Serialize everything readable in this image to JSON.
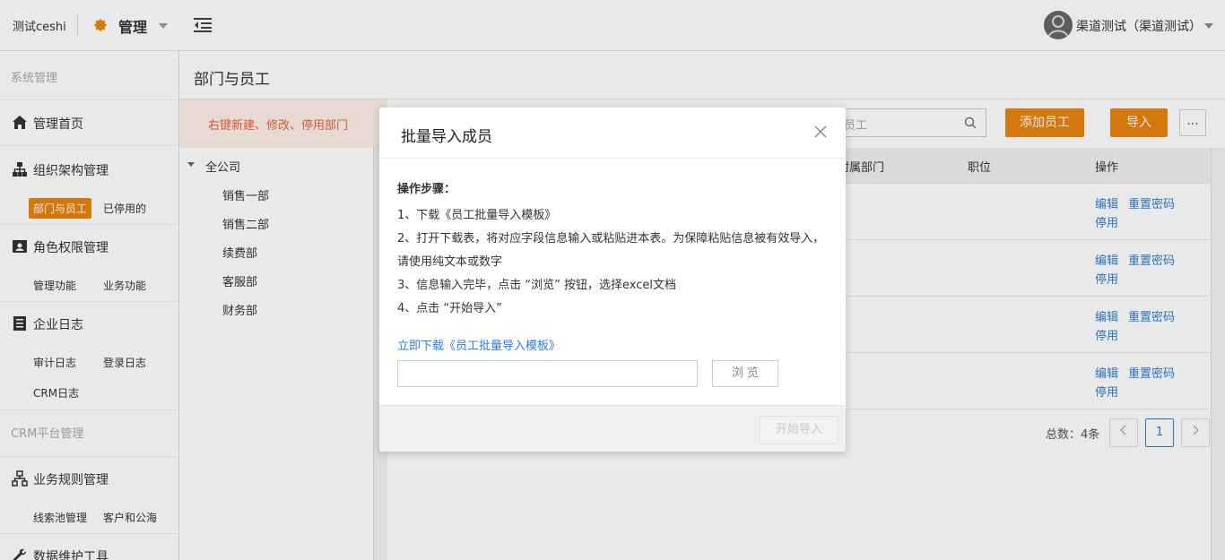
{
  "topbar": {
    "brand": "测试ceshi",
    "module": "管理",
    "user": "渠道测试（渠道测试）"
  },
  "sidebar": {
    "section_system": "系统管理",
    "section_crm": "CRM平台管理",
    "nav": {
      "home": "管理首页",
      "org": "组织架构管理",
      "roles": "角色权限管理",
      "logs": "企业日志",
      "rules": "业务规则管理",
      "data": "数据维护工具"
    },
    "org_subs": [
      "部门与员工",
      "已停用的"
    ],
    "role_subs": [
      "管理功能",
      "业务功能"
    ],
    "log_subs": [
      "审计日志",
      "登录日志",
      "CRM日志"
    ],
    "rule_subs": [
      "线索池管理",
      "客户和公海"
    ]
  },
  "page": {
    "title": "部门与员工",
    "hint": "右键新建、修改、停用部门"
  },
  "tree": {
    "root": "全公司",
    "items": [
      "销售一部",
      "销售二部",
      "续费部",
      "客服部",
      "财务部"
    ]
  },
  "toolbar": {
    "search_placeholder": "员工",
    "add_label": "添加员工",
    "import_label": "导入",
    "more_label": "..."
  },
  "table": {
    "headers": [
      "附属部门",
      "职位",
      "操作"
    ],
    "actions": {
      "edit": "编辑",
      "reset": "重置密码",
      "disable": "停用"
    }
  },
  "pagination": {
    "total": "总数：4条",
    "current": "1"
  },
  "modal": {
    "title": "批量导入成员",
    "steps_heading": "操作步骤：",
    "steps": [
      "1、下载《员工批量导入模板》",
      "2、打开下载表，将对应字段信息输入或粘贴进本表。为保障粘贴信息被有效导入，请使用纯文本或数字",
      "3、信息输入完毕，点击 “浏览” 按钮，选择excel文档",
      "4、点击 “开始导入”"
    ],
    "download_link": "立即下载《员工批量导入模板》",
    "browse_label": "浏 览",
    "start_label": "开始导入"
  },
  "colors": {
    "accent": "#e8830f",
    "link": "#2f7dd1",
    "hint_text": "#e8603c"
  }
}
